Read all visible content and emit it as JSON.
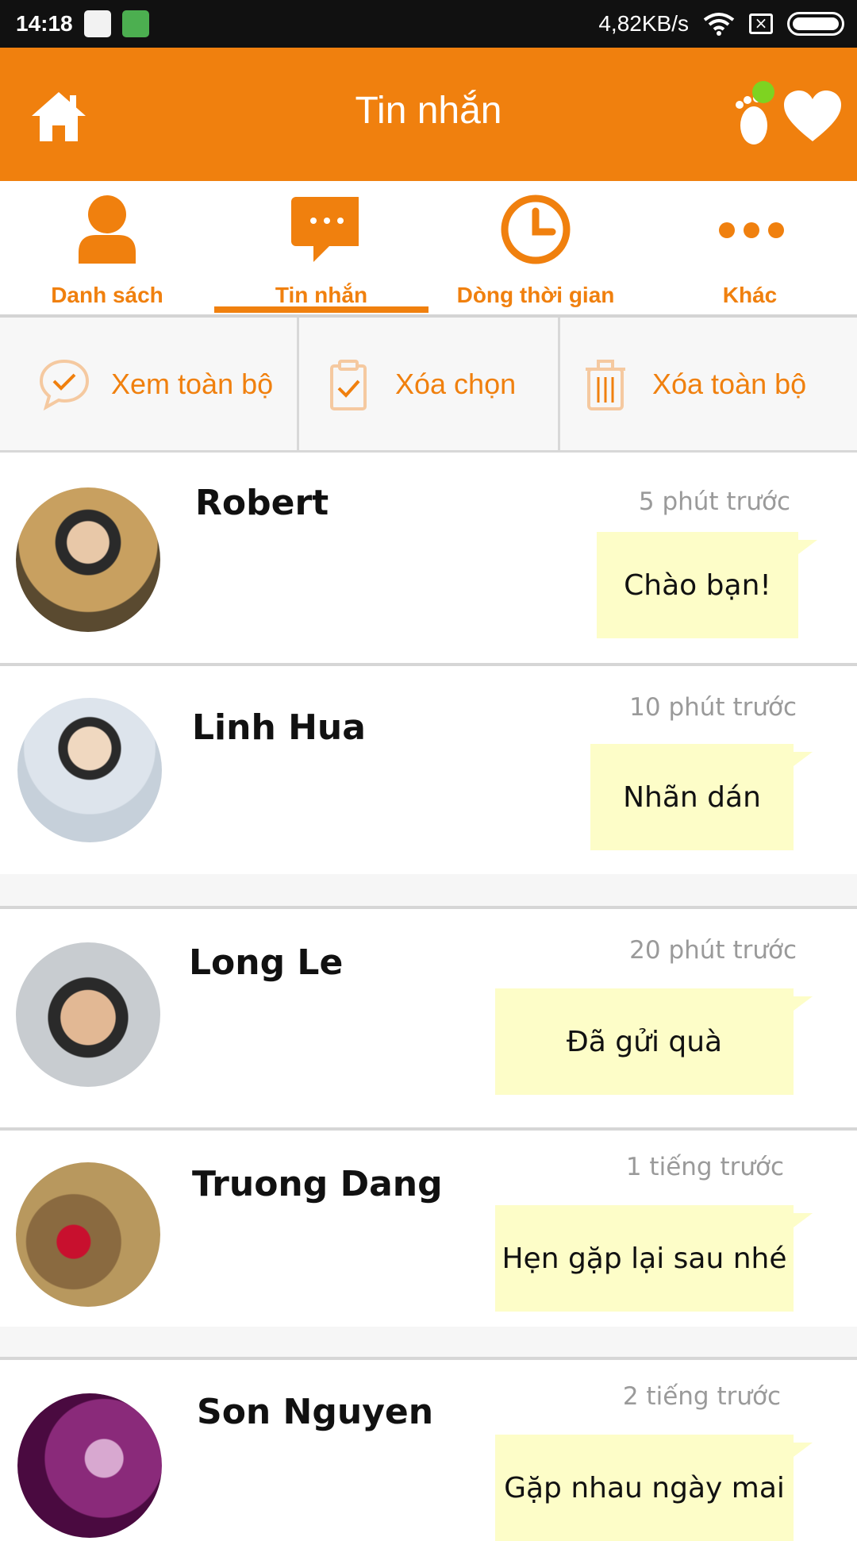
{
  "status_bar": {
    "time": "14:18",
    "network_speed": "4,82KB/s"
  },
  "header": {
    "title": "Tin nhắn",
    "left_icon": "home-icon",
    "right_icons": [
      "footprint-icon",
      "heart-icon"
    ],
    "color": "#f0800e"
  },
  "tabs": [
    {
      "label": "Danh sách",
      "icon": "person-icon",
      "active": false
    },
    {
      "label": "Tin nhắn",
      "icon": "chat-bubble-icon",
      "active": true
    },
    {
      "label": "Dòng thời gian",
      "icon": "clock-icon",
      "active": false
    },
    {
      "label": "Khác",
      "icon": "more-dots-icon",
      "active": false
    }
  ],
  "actions": [
    {
      "label": "Xem toàn bộ",
      "icon": "chat-check-icon"
    },
    {
      "label": "Xóa chọn",
      "icon": "clipboard-check-icon"
    },
    {
      "label": "Xóa toàn bộ",
      "icon": "trash-icon"
    }
  ],
  "conversations": [
    {
      "name": "Robert",
      "time": "5 phút trước",
      "message": "Chào bạn!"
    },
    {
      "name": "Linh Hua",
      "time": "10 phút trước",
      "message": "Nhãn dán"
    },
    {
      "name": "Long Le",
      "time": "20 phút trước",
      "message": "Đã gửi quà"
    },
    {
      "name": "Truong Dang",
      "time": "1 tiếng trước",
      "message": "Hẹn gặp lại sau nhé"
    },
    {
      "name": "Son Nguyen",
      "time": "2 tiếng trước",
      "message": "Gặp nhau ngày mai"
    }
  ]
}
